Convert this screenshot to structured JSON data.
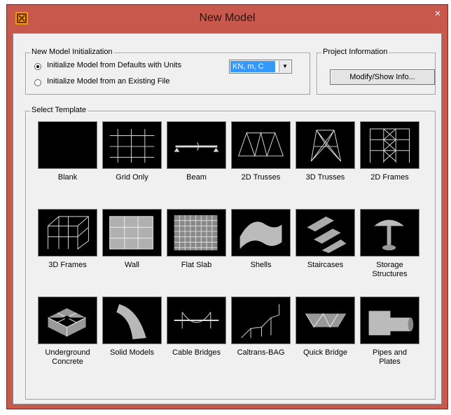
{
  "window": {
    "title": "New Model",
    "close_glyph": "×"
  },
  "init": {
    "legend": "New Model Initialization",
    "option_defaults": "Initialize Model from Defaults with Units",
    "option_existing": "Initialize Model  from an Existing File",
    "selected_option": "defaults",
    "units_value": "KN, m, C"
  },
  "project": {
    "legend": "Project Information",
    "button_label": "Modify/Show Info..."
  },
  "templates": {
    "legend": "Select Template",
    "items": [
      {
        "label": "Blank"
      },
      {
        "label": "Grid Only"
      },
      {
        "label": "Beam"
      },
      {
        "label": "2D Trusses"
      },
      {
        "label": "3D Trusses"
      },
      {
        "label": "2D Frames"
      },
      {
        "label": "3D Frames"
      },
      {
        "label": "Wall"
      },
      {
        "label": "Flat Slab"
      },
      {
        "label": "Shells"
      },
      {
        "label": "Staircases"
      },
      {
        "label": "Storage\nStructures"
      },
      {
        "label": "Underground\nConcrete"
      },
      {
        "label": "Solid Models"
      },
      {
        "label": "Cable Bridges"
      },
      {
        "label": "Caltrans-BAG"
      },
      {
        "label": "Quick Bridge"
      },
      {
        "label": "Pipes and\nPlates"
      }
    ]
  }
}
